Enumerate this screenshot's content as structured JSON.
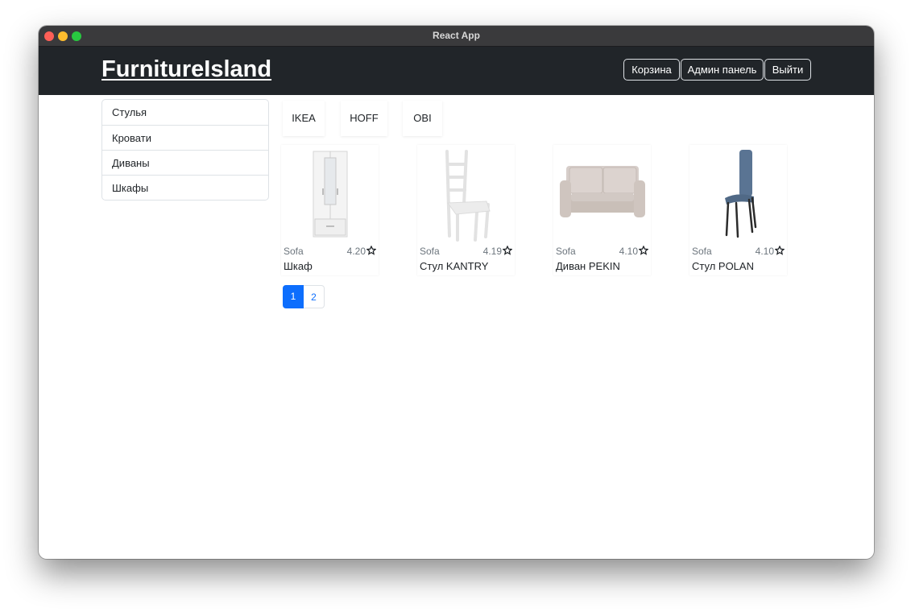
{
  "window": {
    "title": "React App"
  },
  "navbar": {
    "brand": "FurnitureIsland",
    "buttons": [
      "Корзина",
      "Админ панель",
      "Выйти"
    ],
    "bg_color": "#212529"
  },
  "sidebar": {
    "items": [
      "Стулья",
      "Кровати",
      "Диваны",
      "Шкафы"
    ]
  },
  "brands": [
    "IKEA",
    "HOFF",
    "OBI"
  ],
  "products": [
    {
      "brand": "Sofa",
      "rating": "4.20",
      "name": "Шкаф",
      "image": "wardrobe"
    },
    {
      "brand": "Sofa",
      "rating": "4.19",
      "name": "Стул KANTRY",
      "image": "white-chair"
    },
    {
      "brand": "Sofa",
      "rating": "4.10",
      "name": "Диван PEKIN",
      "image": "sofa"
    },
    {
      "brand": "Sofa",
      "rating": "4.10",
      "name": "Стул POLAN",
      "image": "blue-chair"
    }
  ],
  "pagination": {
    "pages": [
      "1",
      "2"
    ],
    "active": "1",
    "accent_color": "#0d6efd"
  }
}
